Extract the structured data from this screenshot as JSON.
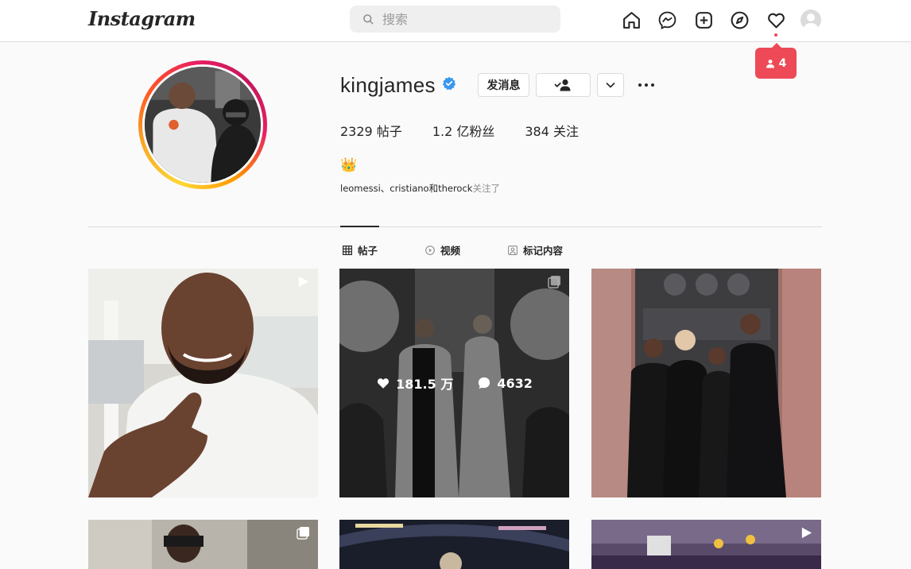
{
  "nav": {
    "logo": "Instagram",
    "search_placeholder": "搜索"
  },
  "notifications": {
    "follower_count": "4"
  },
  "profile": {
    "username": "kingjames",
    "message_button": "发消息",
    "stats": {
      "posts": "2329 帖子",
      "followers": "1.2 亿粉丝",
      "following": "384 关注"
    },
    "bio_emoji": "👑",
    "followed_by_names": "leomessi、cristiano和therock",
    "followed_by_suffix": "关注了"
  },
  "tabs": [
    {
      "label": "帖子"
    },
    {
      "label": "视频"
    },
    {
      "label": "标记内容"
    }
  ],
  "posts": {
    "hovered": {
      "likes": "181.5 万",
      "comments": "4632"
    }
  },
  "colors": {
    "accent_red": "#ed4956",
    "verified_blue": "#3897f0"
  }
}
